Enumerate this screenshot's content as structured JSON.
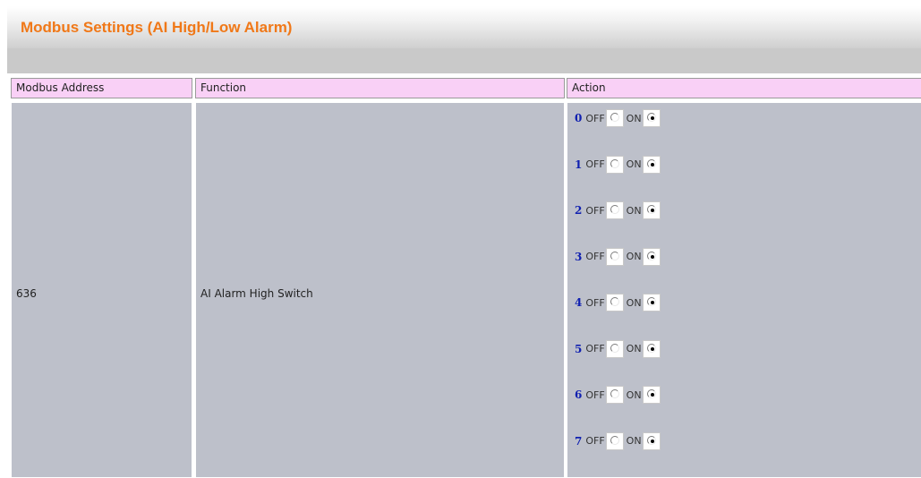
{
  "page_title": "Modbus Settings (AI High/Low Alarm)",
  "table": {
    "headers": [
      "Modbus Address",
      "Function",
      "Action"
    ],
    "rows": [
      {
        "address": "636",
        "function": "AI Alarm High Switch",
        "channels": [
          {
            "bit": "0",
            "off_label": "OFF",
            "on_label": "ON",
            "selected": "ON"
          },
          {
            "bit": "1",
            "off_label": "OFF",
            "on_label": "ON",
            "selected": "ON"
          },
          {
            "bit": "2",
            "off_label": "OFF",
            "on_label": "ON",
            "selected": "ON"
          },
          {
            "bit": "3",
            "off_label": "OFF",
            "on_label": "ON",
            "selected": "ON"
          },
          {
            "bit": "4",
            "off_label": "OFF",
            "on_label": "ON",
            "selected": "ON"
          },
          {
            "bit": "5",
            "off_label": "OFF",
            "on_label": "ON",
            "selected": "ON"
          },
          {
            "bit": "6",
            "off_label": "OFF",
            "on_label": "ON",
            "selected": "ON"
          },
          {
            "bit": "7",
            "off_label": "OFF",
            "on_label": "ON",
            "selected": "ON"
          }
        ]
      }
    ]
  },
  "colors": {
    "title_orange": "#f07818",
    "header_pink": "#f9d0f6",
    "cell_gray": "#bdc0ca",
    "bit_blue": "#1020b0"
  }
}
